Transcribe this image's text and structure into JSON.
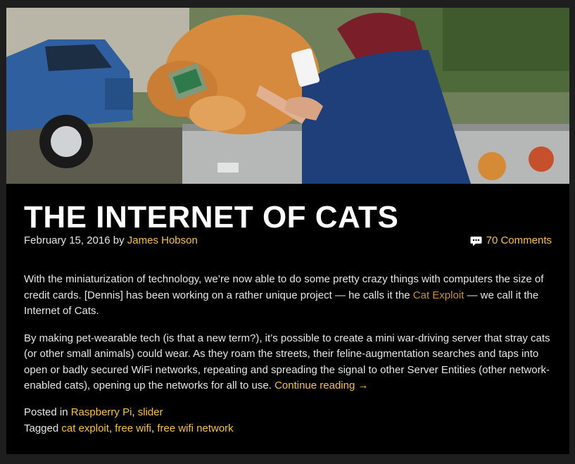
{
  "post": {
    "title": "THE INTERNET OF CATS",
    "date": "February 15, 2016",
    "by": "by",
    "author": "James Hobson",
    "comments": "70 Comments",
    "p1_before": "With the miniaturization of technology, we’re now able to do some pretty crazy things with computers the size of credit cards. [Dennis] has been working on a rather unique project — he calls it the ",
    "p1_link": "Cat Exploit",
    "p1_after": " — we call it the Internet of Cats.",
    "p2": "By making pet-wearable tech (is that a new term?), it’s possible to create a mini war-driving server that stray cats (or other small animals) could wear. As they roam the streets, their feline-augmentation searches and taps into open or badly secured WiFi networks, repeating and spreading the signal to other Server Entities (other network-enabled cats), opening up the networks for all to use. ",
    "continue": "Continue reading →",
    "posted_in_label": "Posted in",
    "categories": [
      "Raspberry Pi",
      "slider"
    ],
    "tagged_label": "Tagged",
    "tags": [
      "cat exploit",
      "free wifi",
      "free wifi network"
    ]
  },
  "colors": {
    "link": "#f7c234",
    "card_bg": "#000000",
    "page_bg": "#1e1e1e"
  },
  "icons": {
    "comments": "speech-bubble-icon"
  }
}
